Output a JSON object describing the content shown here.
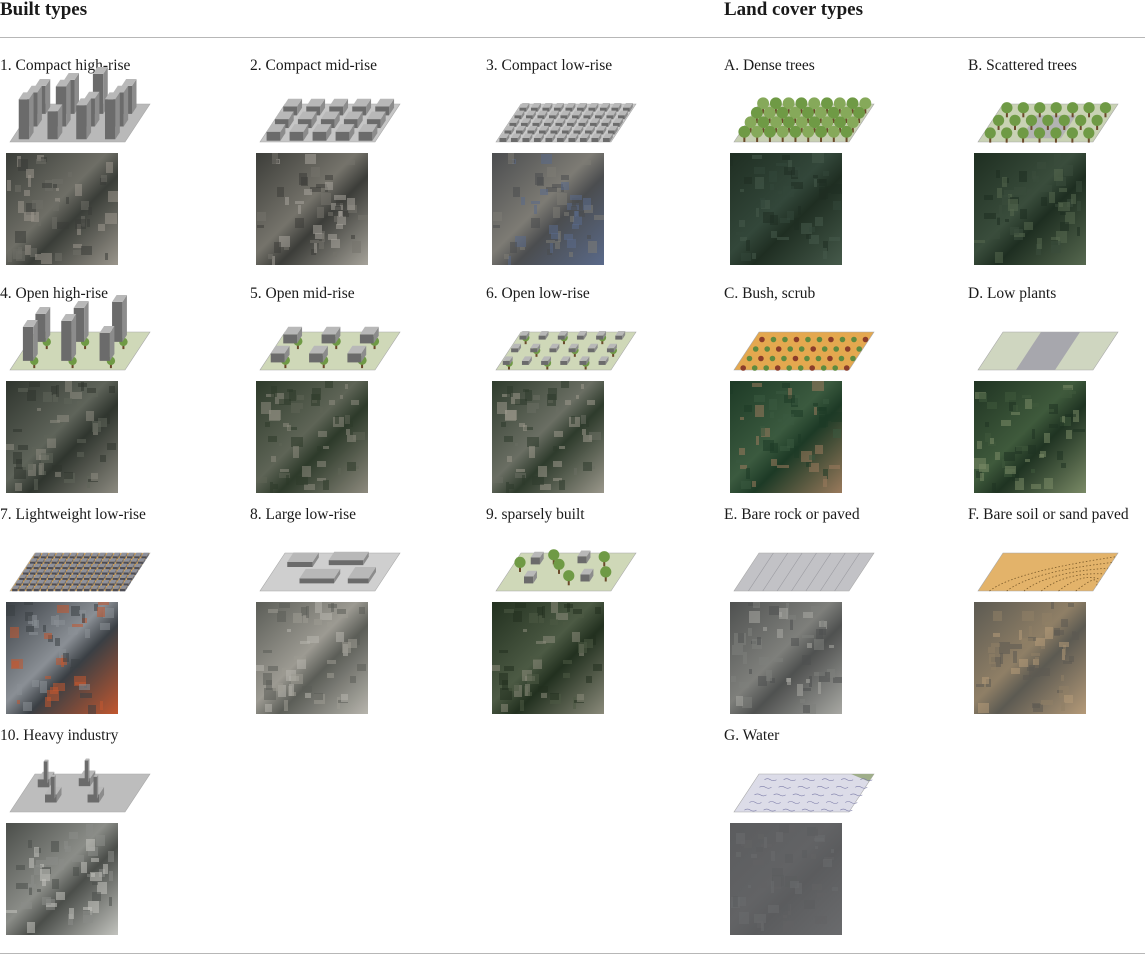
{
  "headers": {
    "built": "Built types",
    "land": "Land cover types"
  },
  "built_types": [
    {
      "label": "1. Compact high-rise",
      "icon": "compact-high-rise-icon",
      "kind": "tall",
      "dense": true,
      "trees": false,
      "ground": "#b9b9b9",
      "photo": [
        "#3a3d38",
        "#6e6e66",
        "#9a968c"
      ]
    },
    {
      "label": "2. Compact mid-rise",
      "icon": "compact-mid-rise-icon",
      "kind": "mid",
      "dense": true,
      "trees": false,
      "ground": "#c6c6c6",
      "photo": [
        "#3c3d39",
        "#75736b",
        "#a6a39a"
      ]
    },
    {
      "label": "3. Compact low-rise",
      "icon": "compact-low-rise-icon",
      "kind": "low",
      "dense": true,
      "trees": false,
      "ground": "#c9c9c9",
      "photo": [
        "#4b4d4f",
        "#7d7b74",
        "#5a6a8a"
      ]
    },
    {
      "label": "4. Open high-rise",
      "icon": "open-high-rise-icon",
      "kind": "tall",
      "dense": false,
      "trees": true,
      "ground": "#cfd8b8",
      "photo": [
        "#2f352e",
        "#5f645a",
        "#8c8a80"
      ]
    },
    {
      "label": "5. Open mid-rise",
      "icon": "open-mid-rise-icon",
      "kind": "mid",
      "dense": false,
      "trees": true,
      "ground": "#cfd8b8",
      "photo": [
        "#2d3a2a",
        "#5e6456",
        "#8d8a7e"
      ]
    },
    {
      "label": "6. Open low-rise",
      "icon": "open-low-rise-icon",
      "kind": "low",
      "dense": false,
      "trees": true,
      "ground": "#cfd8b8",
      "photo": [
        "#2e3b2c",
        "#6a6e63",
        "#9a978b"
      ]
    },
    {
      "label": "7. Lightweight low-rise",
      "icon": "lightweight-low-rise-icon",
      "kind": "tiny",
      "dense": true,
      "trees": false,
      "ground": "#e0a74e",
      "photo": [
        "#3a3f44",
        "#8a8f95",
        "#c2572f"
      ]
    },
    {
      "label": "8. Large low-rise",
      "icon": "large-low-rise-icon",
      "kind": "large",
      "dense": false,
      "trees": false,
      "ground": "#cfcfcf",
      "photo": [
        "#5b5d57",
        "#9c9a92",
        "#b7b5ad"
      ]
    },
    {
      "label": "9. sparsely built",
      "icon": "sparsely-built-icon",
      "kind": "sparse",
      "dense": false,
      "trees": true,
      "ground": "#cfd8b8",
      "photo": [
        "#22301f",
        "#4c5a44",
        "#8a8a7a"
      ]
    },
    {
      "label": "10. Heavy industry",
      "icon": "heavy-industry-icon",
      "kind": "industry",
      "dense": false,
      "trees": false,
      "ground": "#bdbdbd",
      "photo": [
        "#4b4e4a",
        "#8b8d88",
        "#c2c3be"
      ]
    }
  ],
  "land_types": [
    {
      "label": "A. Dense trees",
      "icon": "dense-trees-icon",
      "kind": "trees-dense",
      "ground": "#c7cfb2",
      "photo": [
        "#1f2e22",
        "#33473a",
        "#465a4b"
      ]
    },
    {
      "label": "B. Scattered trees",
      "icon": "scattered-trees-icon",
      "kind": "trees-scattered",
      "ground": "#c9d2b4",
      "photo": [
        "#1e2e21",
        "#3a4d3c",
        "#56684f"
      ]
    },
    {
      "label": "C. Bush, scrub",
      "icon": "bush-scrub-icon",
      "kind": "bush",
      "ground": "#e4a84f",
      "photo": [
        "#1d3a26",
        "#3b5a3f",
        "#9a7a5c"
      ]
    },
    {
      "label": "D. Low plants",
      "icon": "low-plants-icon",
      "kind": "lowplants",
      "ground": "#cfd6c0",
      "photo": [
        "#1f3322",
        "#3f5a3c",
        "#7a8a66"
      ]
    },
    {
      "label": "E. Bare rock or paved",
      "icon": "bare-rock-paved-icon",
      "kind": "paved",
      "ground": "#c2c2c6",
      "photo": [
        "#4f5150",
        "#7e7f7b",
        "#a8a8a3"
      ]
    },
    {
      "label": "F. Bare soil or sand paved",
      "icon": "bare-soil-sand-icon",
      "kind": "soil",
      "ground": "#e3b36a",
      "photo": [
        "#5c5a52",
        "#8f7f66",
        "#b59a78"
      ]
    },
    {
      "label": "G. Water",
      "icon": "water-icon",
      "kind": "water",
      "ground": "#dcdce8",
      "photo": [
        "#5b5c5e",
        "#626365",
        "#6a6b6d"
      ]
    }
  ]
}
